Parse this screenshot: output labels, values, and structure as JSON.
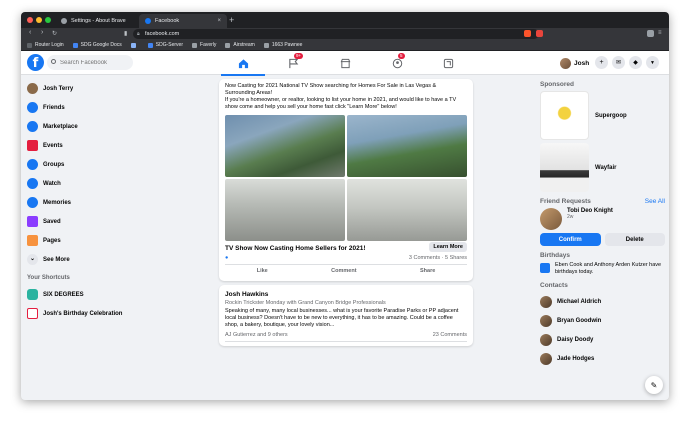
{
  "browser": {
    "tabs": [
      {
        "title": "Settings - About Brave",
        "active": false
      },
      {
        "title": "Facebook",
        "active": true
      }
    ],
    "url": "facebook.com",
    "bookmarks": [
      {
        "label": "Router Login",
        "color": "#5f6368"
      },
      {
        "label": "SDG Google Docs",
        "color": "#4285f4"
      },
      {
        "label": "",
        "color": "#8ab4f8"
      },
      {
        "label": "SDG-Server",
        "color": "#4285f4"
      },
      {
        "label": "Faverly",
        "color": "#9aa0a6"
      },
      {
        "label": "Airstream",
        "color": "#9aa0a6"
      },
      {
        "label": "1663 Pawnee",
        "color": "#9aa0a6"
      }
    ],
    "colors": {
      "close": "#ff5f57",
      "minimize": "#febc2e",
      "maximize": "#28c840"
    }
  },
  "header": {
    "search_placeholder": "Search Facebook",
    "nav_icons": [
      "home-icon",
      "flag-icon",
      "marketplace-icon",
      "groups-icon",
      "gaming-icon"
    ],
    "notification_badges": {
      "pages": "9+",
      "groups": "5"
    },
    "profile_name": "Josh"
  },
  "left_nav": {
    "items": [
      {
        "label": "Josh Terry",
        "color": "#8a6a4a"
      },
      {
        "label": "Friends",
        "color": "#1877f2"
      },
      {
        "label": "Marketplace",
        "color": "#1877f2"
      },
      {
        "label": "Events",
        "color": "#e41e3f"
      },
      {
        "label": "Groups",
        "color": "#1877f2"
      },
      {
        "label": "Watch",
        "color": "#1877f2"
      },
      {
        "label": "Memories",
        "color": "#1877f2"
      },
      {
        "label": "Saved",
        "color": "#8b3dff"
      },
      {
        "label": "Pages",
        "color": "#f7923e"
      }
    ],
    "see_more": "See More",
    "shortcuts_heading": "Your Shortcuts",
    "shortcuts": [
      {
        "label": "SIX DEGREES",
        "color": "#2bb3a0"
      },
      {
        "label": "Josh's Birthday Celebration",
        "color": "#e41e3f"
      }
    ]
  },
  "feed": {
    "post1": {
      "text_lines": [
        "Now Casting for 2021 National TV Show searching for Homes For Sale in Las Vegas &",
        "Surrounding Areas!",
        "If you're a homeowner, or realtor, looking to list your home in 2021, and would like to have a TV",
        "show come and help you sell your home fast click \"Learn More\" below!"
      ],
      "link_title": "TV Show Now Casting Home Sellers for 2021!",
      "learn_more": "Learn More",
      "comments": "3 Comments",
      "shares": "5 Shares",
      "actions": [
        "Like",
        "Comment",
        "Share"
      ]
    },
    "post2": {
      "author": "Josh Hawkins",
      "shared_with": "Rockin Trickster Monday with Grand Canyon Bridge Professionals",
      "text_lines": [
        "Speaking of many, many local businesses... what is your favorite Paradise Parks or PP adjacent",
        "local business? Doesn't have to be new to everything, it has to be amazing. Could be a coffee",
        "shop, a bakery, boutique, your lovely vision..."
      ],
      "reactions": "AJ Gutierrez and 9 others",
      "comments": "23 Comments"
    }
  },
  "right_col": {
    "sponsored_heading": "Sponsored",
    "ads": [
      {
        "label": "Supergoop"
      },
      {
        "label": "Wayfair"
      }
    ],
    "requests_heading": "Friend Requests",
    "requests_see_all": "See All",
    "request": {
      "name": "Tobi Deo Knight",
      "meta": "2w"
    },
    "confirm": "Confirm",
    "delete": "Delete",
    "birthdays_heading": "Birthdays",
    "birthday_text": "Eben Cook and Anthony Arden Kutzer have birthdays today.",
    "contacts_heading": "Contacts",
    "contacts": [
      {
        "name": "Michael Aldrich"
      },
      {
        "name": "Bryan Goodwin"
      },
      {
        "name": "Daisy Doody"
      },
      {
        "name": "Jade Hodges"
      }
    ]
  }
}
